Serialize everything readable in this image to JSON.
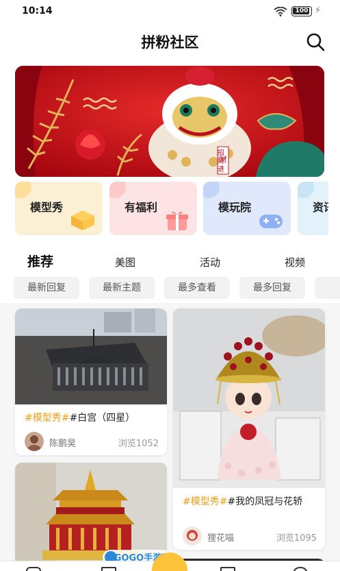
{
  "status_bar": {
    "time": "10:14",
    "battery": "100"
  },
  "header": {
    "title": "拼粉社区"
  },
  "banner": {
    "caption": "招财进"
  },
  "categories": [
    {
      "label": "模型秀",
      "color": "#fbefd4",
      "blob": "#ffd06a",
      "icon": "box-icon"
    },
    {
      "label": "有福利",
      "color": "#fde3e3",
      "blob": "#ffb4b4",
      "icon": "gift-icon"
    },
    {
      "label": "模玩院",
      "color": "#dfe9fb",
      "blob": "#a9c4f5",
      "icon": "gamepad-icon"
    },
    {
      "label": "资讯",
      "color": "#e3f2fa",
      "blob": "#b0dbf0",
      "icon": "news-icon"
    }
  ],
  "tabs": [
    "推荐",
    "美图",
    "活动",
    "视频"
  ],
  "filters": [
    "最新回复",
    "最新主题",
    "最多查看",
    "最多回复"
  ],
  "posts": [
    {
      "tag": "#模型秀#",
      "title": "#白宫（四星）",
      "author": "陈鹏昊",
      "views": "浏览1052"
    },
    {
      "tag": "#模型秀#",
      "title": "#我的凤冠与花轿",
      "author": "狸花喵",
      "views": "浏览1095"
    },
    {
      "tag": "",
      "title": "",
      "author": "",
      "views": ""
    }
  ],
  "watermark": "GOGO手游网",
  "colors": {
    "accent": "#ffd86a",
    "tag": "#f0a018",
    "banner": "#c8101e"
  }
}
